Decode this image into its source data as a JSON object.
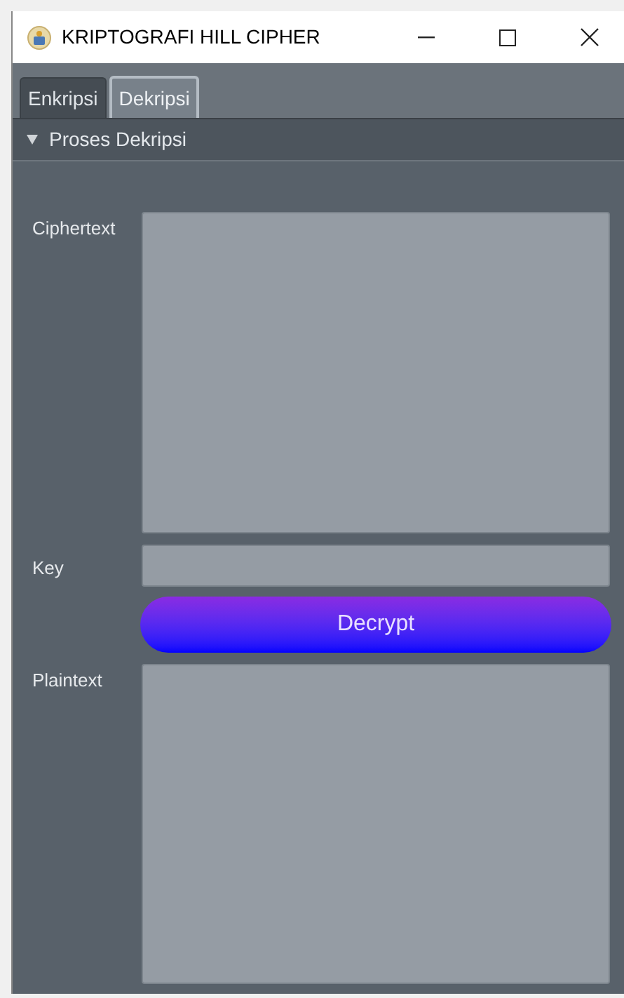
{
  "window": {
    "title": "KRIPTOGRAFI HILL CIPHER"
  },
  "tabs": [
    {
      "label": "Enkripsi",
      "selected": false
    },
    {
      "label": "Dekripsi",
      "selected": true
    }
  ],
  "section": {
    "title": "Proses Dekripsi",
    "expanded": true
  },
  "form": {
    "ciphertext_label": "Ciphertext",
    "key_label": "Key",
    "button": "Decrypt",
    "plaintext_label": "Plaintext"
  }
}
